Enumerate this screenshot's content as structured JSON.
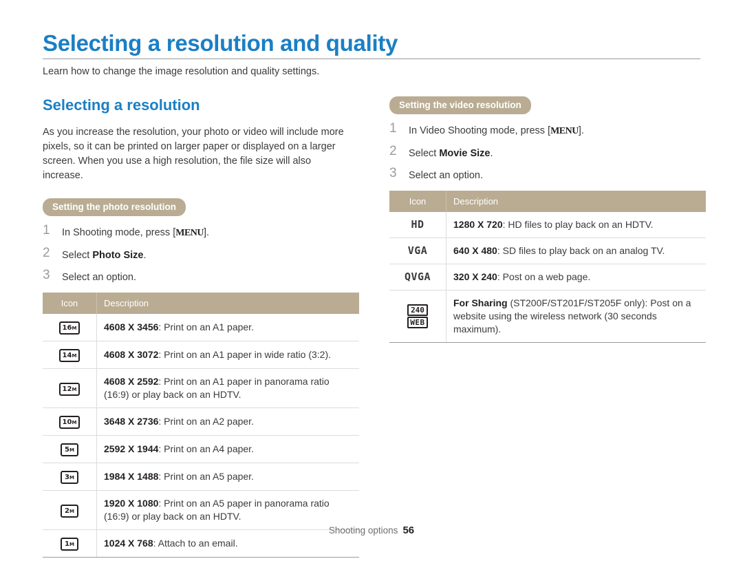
{
  "title": "Selecting a resolution and quality",
  "intro": "Learn how to change the image resolution and quality settings.",
  "left": {
    "heading": "Selecting a resolution",
    "body": "As you increase the resolution, your photo or video will include more pixels, so it can be printed on larger paper or displayed on a larger screen. When you use a high resolution, the file size will also increase.",
    "pill": "Setting the photo resolution",
    "steps": [
      {
        "num": "1",
        "pre": "In Shooting mode, press [",
        "menu": "MENU",
        "post": "]."
      },
      {
        "num": "2",
        "pre": "Select ",
        "bold": "Photo Size",
        "post": "."
      },
      {
        "num": "3",
        "pre": "Select an option.",
        "bold": "",
        "post": ""
      }
    ],
    "table": {
      "headers": [
        "Icon",
        "Description"
      ],
      "rows": [
        {
          "icon": "16",
          "iconsub": "M",
          "value": "4608 X 3456",
          "desc": ": Print on an A1 paper."
        },
        {
          "icon": "14",
          "iconsub": "M",
          "value": "4608 X 3072",
          "desc": ": Print on an A1 paper in wide ratio (3:2)."
        },
        {
          "icon": "12",
          "iconsub": "M",
          "value": "4608 X 2592",
          "desc": ": Print on an A1 paper in panorama ratio (16:9) or play back on an HDTV."
        },
        {
          "icon": "10",
          "iconsub": "M",
          "value": "3648 X 2736",
          "desc": ": Print on an A2 paper."
        },
        {
          "icon": "5",
          "iconsub": "M",
          "value": "2592 X 1944",
          "desc": ": Print on an A4 paper."
        },
        {
          "icon": "3",
          "iconsub": "M",
          "value": "1984 X 1488",
          "desc": ": Print on an A5 paper."
        },
        {
          "icon": "2",
          "iconsub": "M",
          "value": "1920 X 1080",
          "desc": ": Print on an A5 paper in panorama ratio (16:9) or play back on an HDTV."
        },
        {
          "icon": "1",
          "iconsub": "M",
          "value": "1024 X 768",
          "desc": ": Attach to an email."
        }
      ]
    }
  },
  "right": {
    "pill": "Setting the video resolution",
    "steps": [
      {
        "num": "1",
        "pre": "In Video Shooting mode, press [",
        "menu": "MENU",
        "post": "]."
      },
      {
        "num": "2",
        "pre": "Select ",
        "bold": "Movie Size",
        "post": "."
      },
      {
        "num": "3",
        "pre": "Select an option.",
        "bold": "",
        "post": ""
      }
    ],
    "table": {
      "headers": [
        "Icon",
        "Description"
      ],
      "rows": [
        {
          "icon": "HD",
          "value": "1280 X 720",
          "desc": ": HD files to play back on an HDTV."
        },
        {
          "icon": "VGA",
          "value": "640 X 480",
          "desc": ": SD files to play back on an analog TV."
        },
        {
          "icon": "QVGA",
          "value": "320 X 240",
          "desc": ": Post on a web page."
        },
        {
          "icon": "240WEB",
          "icon_top": "240",
          "icon_bot": "WEB",
          "value": "For Sharing",
          "desc": " (ST200F/ST201F/ST205F only): Post on a website using the wireless network (30 seconds maximum)."
        }
      ]
    }
  },
  "footer": {
    "label": "Shooting options",
    "page": "56"
  },
  "colors": {
    "accent": "#1b7fc4",
    "pill": "#b9ac93",
    "rule": "#9a9a9a"
  }
}
